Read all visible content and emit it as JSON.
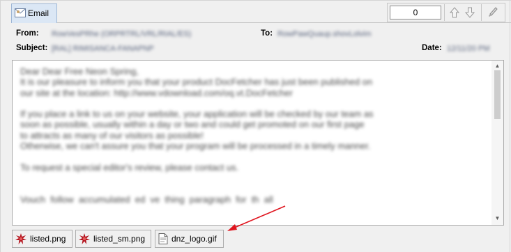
{
  "tab": {
    "label": "Email"
  },
  "toolbar": {
    "counter_value": "0"
  },
  "header": {
    "from_label": "From:",
    "from_value": "RowVesPRhe (ORPRTRL/VRL/RIAL/ES)",
    "to_label": "To:",
    "to_value": "RowPawQuaup.shovLolvim",
    "subject_label": "Subject:",
    "subject_value": "[RAL] RIMISANCA-FANAPNP",
    "date_label": "Date:",
    "date_value": "12/11/20 PM"
  },
  "message": {
    "body": "Dear Dear Free Neon Spring,\nIt is our pleasure to inform you that your product DocFetcher has just been published on\nour site at the location: http://www.vdownload.com/oq.vt.DocFetcher\n\nIf you place a link to us on your website, your application will be checked by our team as\nsoon as possible, usually within a day or two and could get promoted on our first page\nto attracts as many of our visitors as possible!\nOtherwise, we can't assure you that your program will be processed in a timely manner.\n\nTo request a special editor's review, please contact us.\n\n\nVouch  follow  accumulated  ed  ve  thing  paragraph  for  th  all"
  },
  "attachments": [
    {
      "name": "listed.png",
      "icon": "red-splat-icon"
    },
    {
      "name": "listed_sm.png",
      "icon": "red-splat-icon"
    },
    {
      "name": "dnz_logo.gif",
      "icon": "document-icon"
    }
  ],
  "colors": {
    "tab_bg": "#dbe7f5",
    "annotation_arrow": "#e0141e"
  }
}
